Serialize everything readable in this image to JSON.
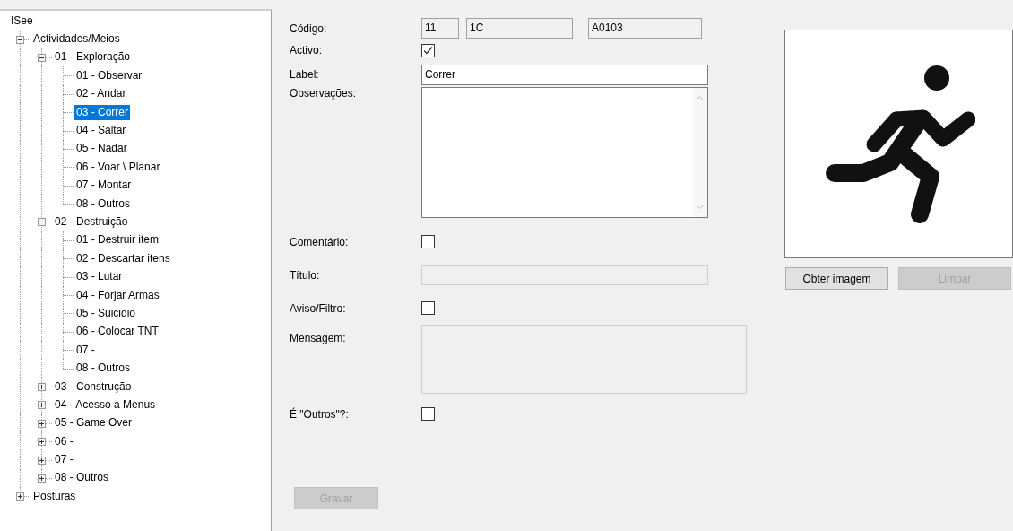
{
  "tree": {
    "label": "ISee",
    "selected": false,
    "children": [
      {
        "label": "Actividades/Meios",
        "selected": false,
        "expanded": true,
        "children": [
          {
            "label": "01 - Exploração",
            "selected": false,
            "expanded": true,
            "children": [
              {
                "label": "01 - Observar",
                "selected": false
              },
              {
                "label": "02 - Andar",
                "selected": false
              },
              {
                "label": "03 - Correr",
                "selected": true
              },
              {
                "label": "04 - Saltar",
                "selected": false
              },
              {
                "label": "05 - Nadar",
                "selected": false
              },
              {
                "label": "06 - Voar \\ Planar",
                "selected": false
              },
              {
                "label": "07 - Montar",
                "selected": false
              },
              {
                "label": "08 - Outros",
                "selected": false
              }
            ]
          },
          {
            "label": "02 - Destruição",
            "selected": false,
            "expanded": true,
            "children": [
              {
                "label": "01 - Destruir item",
                "selected": false
              },
              {
                "label": "02 - Descartar itens",
                "selected": false
              },
              {
                "label": "03 - Lutar",
                "selected": false
              },
              {
                "label": "04 - Forjar Armas",
                "selected": false
              },
              {
                "label": "05 - Suicidio",
                "selected": false
              },
              {
                "label": "06 - Colocar TNT",
                "selected": false
              },
              {
                "label": "07 -",
                "selected": false
              },
              {
                "label": "08 - Outros",
                "selected": false
              }
            ]
          },
          {
            "label": "03 - Construção",
            "selected": false,
            "expanded": false
          },
          {
            "label": "04 - Acesso a Menus",
            "selected": false,
            "expanded": false
          },
          {
            "label": "05 - Game Over",
            "selected": false,
            "expanded": false
          },
          {
            "label": "06 -",
            "selected": false,
            "expanded": false
          },
          {
            "label": "07 -",
            "selected": false,
            "expanded": false
          },
          {
            "label": "08 - Outros",
            "selected": false,
            "expanded": false
          }
        ]
      },
      {
        "label": "Posturas",
        "selected": false,
        "expanded": false
      }
    ]
  },
  "form": {
    "code": {
      "label": "Código:",
      "values": [
        "11",
        "1C",
        "A0103"
      ]
    },
    "active": {
      "label": "Activo:",
      "checked": true
    },
    "label": {
      "label": "Label:",
      "value": "Correr"
    },
    "notes": {
      "label": "Observações:"
    },
    "comment": {
      "label": "Comentário:",
      "checked": false
    },
    "title": {
      "label": "Título:",
      "disabled": true
    },
    "warning": {
      "label": "Aviso/Filtro:",
      "checked": false
    },
    "message": {
      "label": "Mensagem:",
      "disabled": true
    },
    "others": {
      "label": "É \"Outros\"?:",
      "checked": false
    },
    "save_button": {
      "label": "Gravar",
      "disabled": true
    }
  },
  "image": {
    "get_button": {
      "label": "Obter imagem",
      "disabled": false
    },
    "clear_button": {
      "label": "Limpar",
      "disabled": true
    }
  }
}
